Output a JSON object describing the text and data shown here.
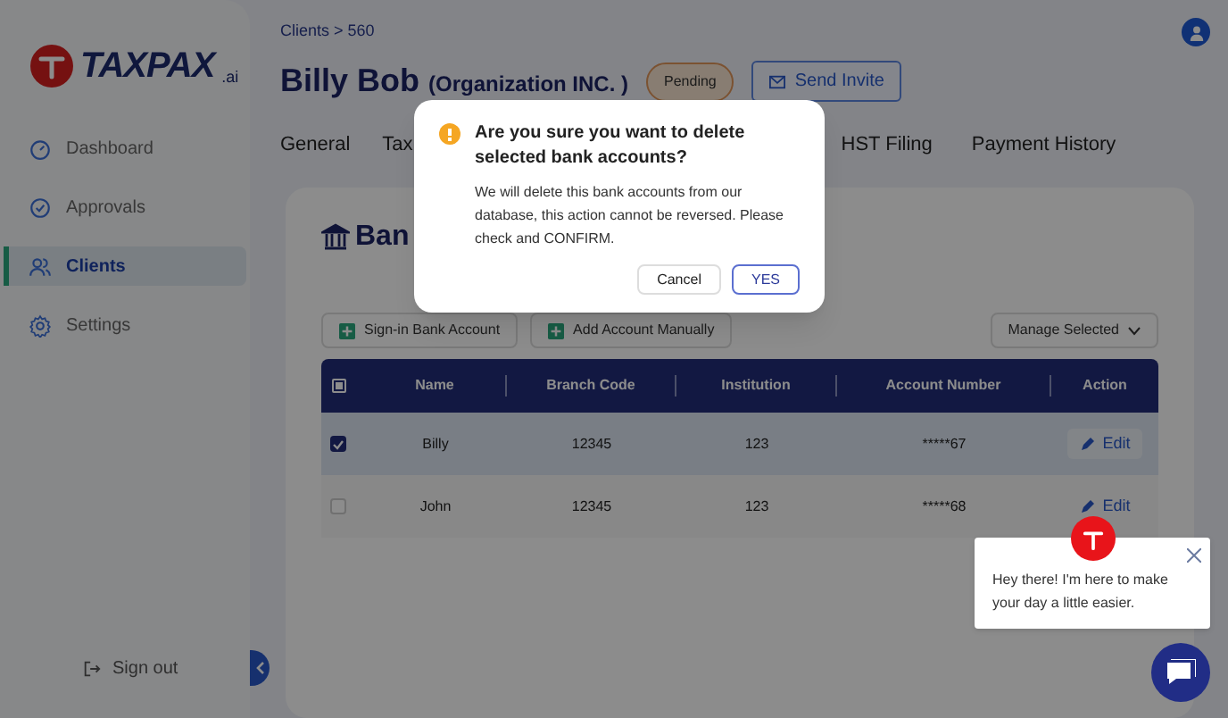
{
  "sidebar": {
    "logo": {
      "text": "TAXPAX",
      "suffix": ".ai"
    },
    "items": [
      {
        "label": "Dashboard",
        "selected": false
      },
      {
        "label": "Approvals",
        "selected": false
      },
      {
        "label": "Clients",
        "selected": true
      },
      {
        "label": "Settings",
        "selected": false
      }
    ],
    "sign_out": "Sign out"
  },
  "breadcrumb": "Clients > 560",
  "client": {
    "name": "Billy Bob",
    "organization": "(Organization INC. )",
    "status": "Pending",
    "invite_button": "Send Invite"
  },
  "tabs": [
    {
      "label": "General"
    },
    {
      "label": "Tax"
    },
    {
      "label": "HST Filing"
    },
    {
      "label": "Payment History"
    }
  ],
  "card": {
    "title": "Ban",
    "buttons": [
      "Sign-in Bank Account",
      "Add Account Manually"
    ],
    "manage": "Manage Selected"
  },
  "table": {
    "select_all": {
      "indeterminate": true
    },
    "columns": [
      "Name",
      "Branch Code",
      "Institution",
      "Account Number",
      "Action"
    ],
    "rows": [
      {
        "checked": true,
        "cells": [
          "Billy",
          "12345",
          "123",
          "*****67"
        ],
        "action": "Edit"
      },
      {
        "checked": false,
        "cells": [
          "John",
          "12345",
          "123",
          "*****68"
        ],
        "action": "Edit"
      }
    ]
  },
  "dialog": {
    "title": "Are you sure you want to delete selected bank accounts?",
    "message": "We will delete this bank accounts from our database, this action cannot be reversed. Please check and CONFIRM.",
    "buttons": [
      {
        "label": "Cancel",
        "kind": "default"
      },
      {
        "label": "YES",
        "kind": "primary"
      }
    ]
  },
  "chat": {
    "message": "Hey there! I'm here to make your day a little easier."
  }
}
